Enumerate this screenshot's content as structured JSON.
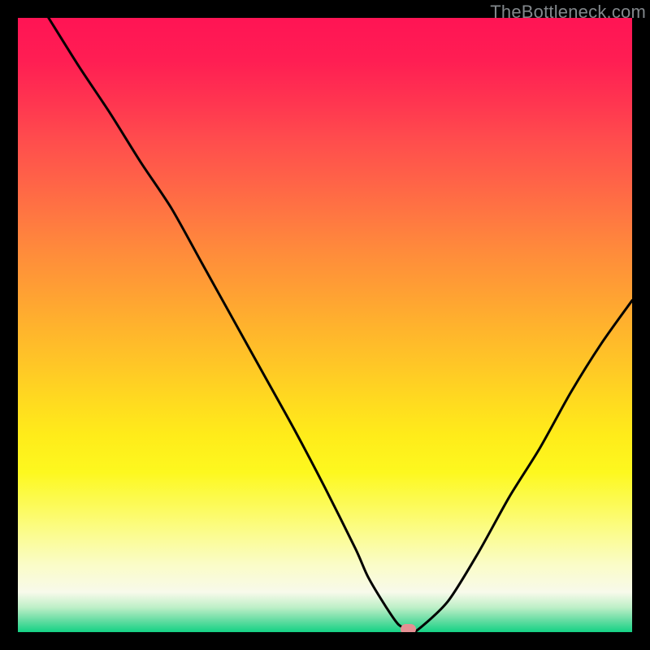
{
  "watermark": "TheBottleneck.com",
  "colors": {
    "gradient_top": "#ff1454",
    "gradient_mid": "#ffd920",
    "gradient_bottom": "#14d285",
    "curve": "#000000",
    "marker": "#e59093",
    "frame_bg": "#000000"
  },
  "chart_data": {
    "type": "line",
    "title": "",
    "xlabel": "",
    "ylabel": "",
    "xlim": [
      0,
      100
    ],
    "ylim": [
      0,
      100
    ],
    "series": [
      {
        "name": "bottleneck-curve",
        "x": [
          5,
          10,
          15,
          20,
          25,
          30,
          35,
          40,
          45,
          50,
          55,
          57,
          60,
          62,
          64,
          65,
          70,
          75,
          80,
          85,
          90,
          95,
          100
        ],
        "values": [
          100,
          92,
          84.5,
          76.5,
          69,
          60,
          51,
          42,
          33,
          23.5,
          13.5,
          9,
          4,
          1.2,
          0.3,
          0.3,
          5,
          13,
          22,
          30,
          39,
          47,
          54
        ]
      }
    ],
    "marker": {
      "x": 63.5,
      "y": 0.4
    },
    "annotations": []
  }
}
